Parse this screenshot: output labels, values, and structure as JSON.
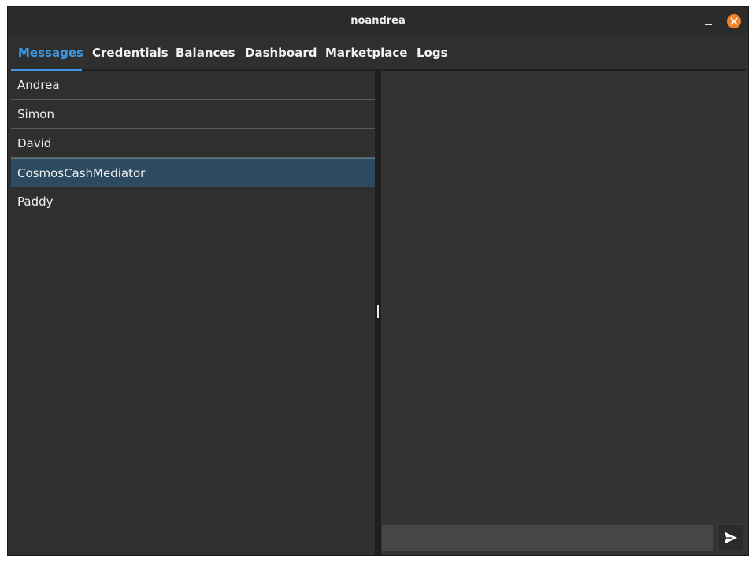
{
  "window": {
    "title": "noandrea"
  },
  "tabs": [
    {
      "label": "Messages",
      "active": true
    },
    {
      "label": "Credentials",
      "active": false
    },
    {
      "label": "Balances",
      "active": false
    },
    {
      "label": "Dashboard",
      "active": false
    },
    {
      "label": "Marketplace",
      "active": false
    },
    {
      "label": "Logs",
      "active": false
    }
  ],
  "contacts": [
    {
      "name": "Andrea",
      "selected": false
    },
    {
      "name": "Simon",
      "selected": false
    },
    {
      "name": "David",
      "selected": false
    },
    {
      "name": "CosmosCashMediator",
      "selected": true
    },
    {
      "name": "Paddy",
      "selected": false
    }
  ],
  "chat": {
    "input_value": "",
    "send_icon": "send-icon"
  },
  "colors": {
    "accent": "#3d98e6",
    "selection": "#2c4a60",
    "close_button": "#f0822a",
    "background": "#2f2f2f"
  }
}
